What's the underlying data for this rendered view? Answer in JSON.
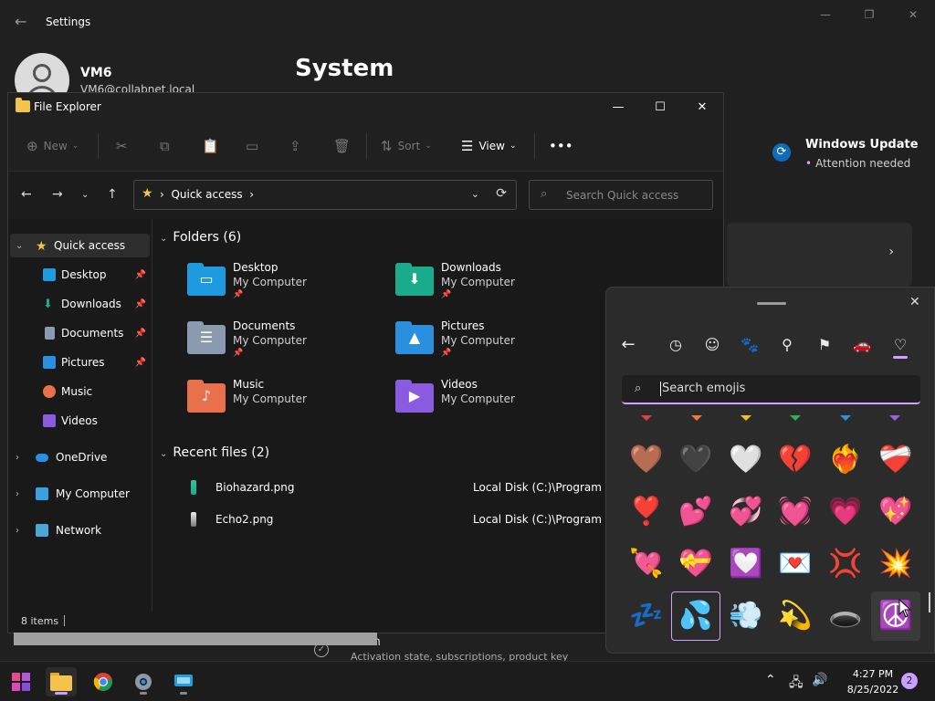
{
  "settings": {
    "title": "Settings",
    "user_name": "VM6",
    "user_email": "VM6@collabnet.local",
    "page_title": "System",
    "windows_update": {
      "title": "Windows Update",
      "status": "Attention needed"
    },
    "activation": {
      "title": "ation",
      "subtitle": "Activation state, subscriptions, product key"
    }
  },
  "explorer": {
    "title": "File Explorer",
    "toolbar": {
      "new": "New",
      "sort": "Sort",
      "view": "View"
    },
    "address": "Quick access",
    "search_placeholder": "Search Quick access",
    "sidebar": [
      {
        "label": "Quick access",
        "icon": "star-icon"
      },
      {
        "label": "Desktop",
        "icon": "desktop-icon"
      },
      {
        "label": "Downloads",
        "icon": "download-icon"
      },
      {
        "label": "Documents",
        "icon": "documents-icon"
      },
      {
        "label": "Pictures",
        "icon": "pictures-icon"
      },
      {
        "label": "Music",
        "icon": "music-icon"
      },
      {
        "label": "Videos",
        "icon": "videos-icon"
      },
      {
        "label": "OneDrive",
        "icon": "cloud-icon"
      },
      {
        "label": "My Computer",
        "icon": "computer-icon"
      },
      {
        "label": "Network",
        "icon": "network-icon"
      }
    ],
    "folders_header": "Folders (6)",
    "folders": [
      {
        "name": "Desktop",
        "location": "My Computer",
        "color": "#1e9be0"
      },
      {
        "name": "Downloads",
        "location": "My Computer",
        "color": "#1aab8a"
      },
      {
        "name": "Documents",
        "location": "My Computer",
        "color": "#8a9bb0"
      },
      {
        "name": "Pictures",
        "location": "My Computer",
        "color": "#2b8fe0"
      },
      {
        "name": "Music",
        "location": "My Computer",
        "color": "#e8704a"
      },
      {
        "name": "Videos",
        "location": "My Computer",
        "color": "#8a5ae0"
      }
    ],
    "recent_header": "Recent files (2)",
    "recent": [
      {
        "name": "Biohazard.png",
        "location": "Local Disk (C:)\\Program File"
      },
      {
        "name": "Echo2.png",
        "location": "Local Disk (C:)\\Program File"
      }
    ],
    "status": "8 items"
  },
  "emoji_panel": {
    "search_placeholder": "Search emojis",
    "categories": [
      "back-icon",
      "recent-icon",
      "smiley-icon",
      "animal-icon",
      "place-icon",
      "party-icon",
      "car-icon",
      "heart-icon"
    ],
    "rows": [
      [
        "🤎",
        "🖤",
        "🤍",
        "💔",
        "❤️‍🔥",
        "❤️‍🩹"
      ],
      [
        "❣️",
        "💕",
        "💞",
        "💓",
        "💗",
        "💖"
      ],
      [
        "💘",
        "💝",
        "💟",
        "💌",
        "💢",
        "💥"
      ],
      [
        "💤",
        "💦",
        "💨",
        "💫",
        "🕳️",
        "☮️"
      ]
    ]
  },
  "taskbar": {
    "time": "4:27 PM",
    "date": "8/25/2022",
    "notifications": "2"
  }
}
